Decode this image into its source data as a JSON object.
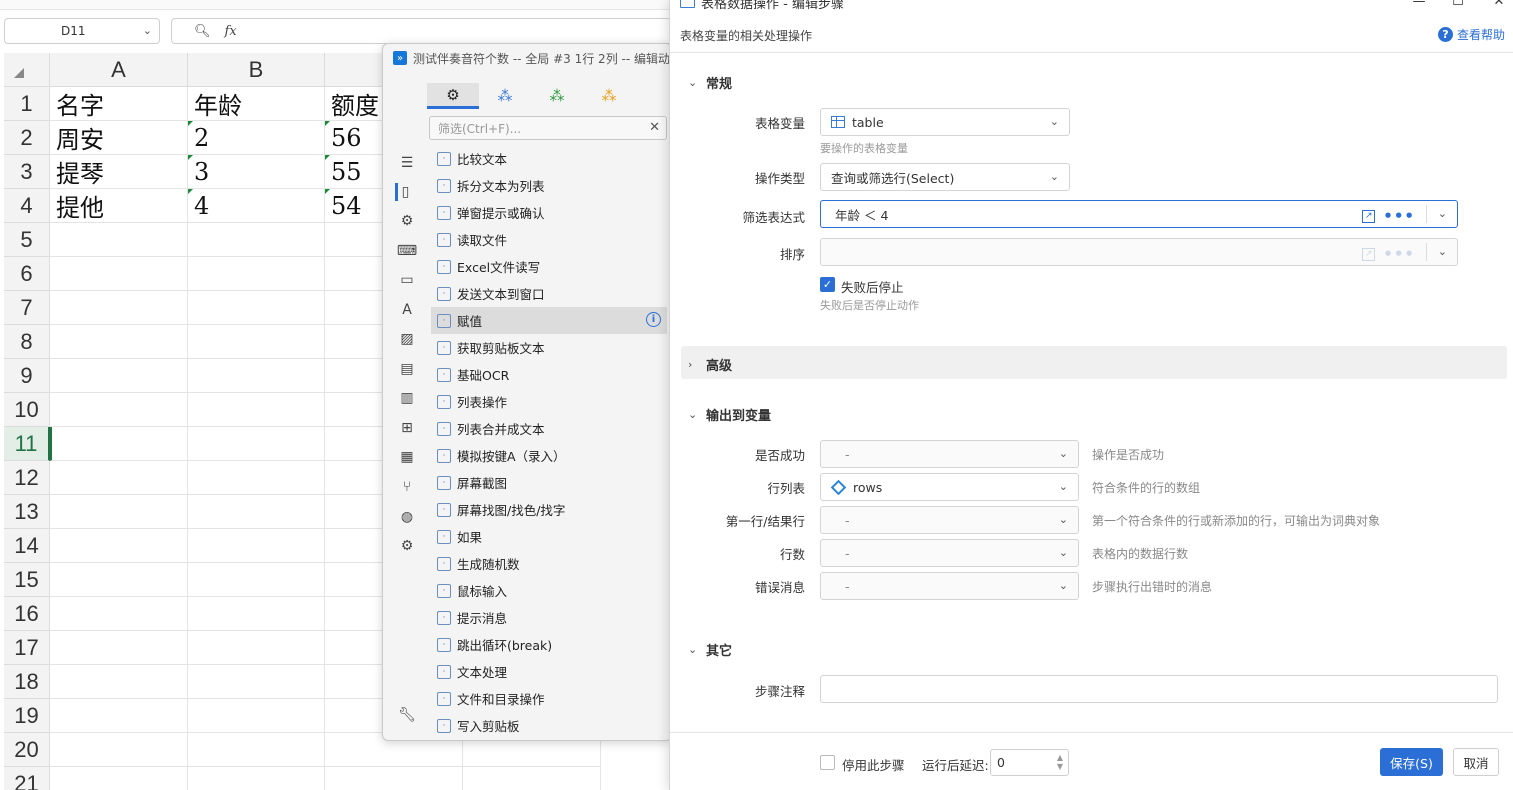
{
  "spreadsheet": {
    "name_box": "D11",
    "formula_icons": [
      "zoom-icon",
      "fx-icon"
    ],
    "columns": [
      "A",
      "B",
      ""
    ],
    "rows": [
      "1",
      "2",
      "3",
      "4",
      "5",
      "6",
      "7",
      "8",
      "9",
      "10",
      "11",
      "12",
      "13",
      "14",
      "15",
      "16",
      "17",
      "18",
      "19",
      "20",
      "21"
    ],
    "data": [
      [
        "名字",
        "年龄",
        "额度"
      ],
      [
        "周安",
        "2",
        "56"
      ],
      [
        "提琴",
        "3",
        "55"
      ],
      [
        "提他",
        "4",
        "54"
      ]
    ],
    "active_row": "11"
  },
  "midpanel": {
    "title": "测试伴奏音符个数 -- 全局 #3 1行 2列 -- 编辑动",
    "search_placeholder": "筛选(Ctrl+F)...",
    "items": [
      {
        "label": "比较文本",
        "icon": "compare-icon"
      },
      {
        "label": "拆分文本为列表",
        "icon": "gear-icon"
      },
      {
        "label": "弹窗提示或确认",
        "icon": "dialog-icon"
      },
      {
        "label": "读取文件",
        "icon": "folder-icon"
      },
      {
        "label": "Excel文件读写",
        "icon": "excel-icon"
      },
      {
        "label": "发送文本到窗口",
        "icon": "message-icon"
      },
      {
        "label": "赋值",
        "icon": "edit-icon"
      },
      {
        "label": "获取剪贴板文本",
        "icon": "clipboard-icon"
      },
      {
        "label": "基础OCR",
        "icon": "scan-icon"
      },
      {
        "label": "列表操作",
        "icon": "list-icon"
      },
      {
        "label": "列表合并成文本",
        "icon": "gear-icon"
      },
      {
        "label": "模拟按键A（录入）",
        "icon": "keyboard-icon"
      },
      {
        "label": "屏幕截图",
        "icon": "scan-icon"
      },
      {
        "label": "屏幕找图/找色/找字",
        "icon": "find-icon"
      },
      {
        "label": "如果",
        "icon": "branch-icon"
      },
      {
        "label": "生成随机数",
        "icon": "gear-icon"
      },
      {
        "label": "鼠标输入",
        "icon": "cursor-icon"
      },
      {
        "label": "提示消息",
        "icon": "megaphone-icon"
      },
      {
        "label": "跳出循环(break)",
        "icon": "exit-icon"
      },
      {
        "label": "文本处理",
        "icon": "gear-icon"
      },
      {
        "label": "文件和目录操作",
        "icon": "folder-icon"
      },
      {
        "label": "写入剪贴板",
        "icon": "clipboard-icon"
      }
    ],
    "highlighted_index": 6
  },
  "dialog": {
    "title": "表格数据操作 - 编辑步骤",
    "subtitle": "表格变量的相关处理操作",
    "help": "查看帮助",
    "sections": {
      "general": "常规",
      "advanced": "高级",
      "output": "输出到变量",
      "other": "其它"
    },
    "fields": {
      "table_var_label": "表格变量",
      "table_var_value": "table",
      "table_var_hint": "要操作的表格变量",
      "op_type_label": "操作类型",
      "op_type_value": "查询或筛选行(Select)",
      "filter_label": "筛选表达式",
      "filter_value": "年龄 ＜ 4",
      "sort_label": "排序",
      "sort_value": "",
      "stop_on_fail_label": "失败后停止",
      "stop_on_fail_hint": "失败后是否停止动作",
      "stop_on_fail_checked": true
    },
    "outputs": [
      {
        "label": "是否成功",
        "value": "-",
        "desc": "操作是否成功"
      },
      {
        "label": "行列表",
        "value": "rows",
        "desc": "符合条件的行的数组"
      },
      {
        "label": "第一行/结果行",
        "value": "-",
        "desc": "第一个符合条件的行或新添加的行，可输出为词典对象"
      },
      {
        "label": "行数",
        "value": "-",
        "desc": "表格内的数据行数"
      },
      {
        "label": "错误消息",
        "value": "-",
        "desc": "步骤执行出错时的消息"
      }
    ],
    "other": {
      "comment_label": "步骤注释",
      "comment_value": ""
    },
    "footer": {
      "disable_label": "停用此步骤",
      "delay_label": "运行后延迟:",
      "delay_value": "0",
      "save": "保存(S)",
      "cancel": "取消"
    }
  }
}
